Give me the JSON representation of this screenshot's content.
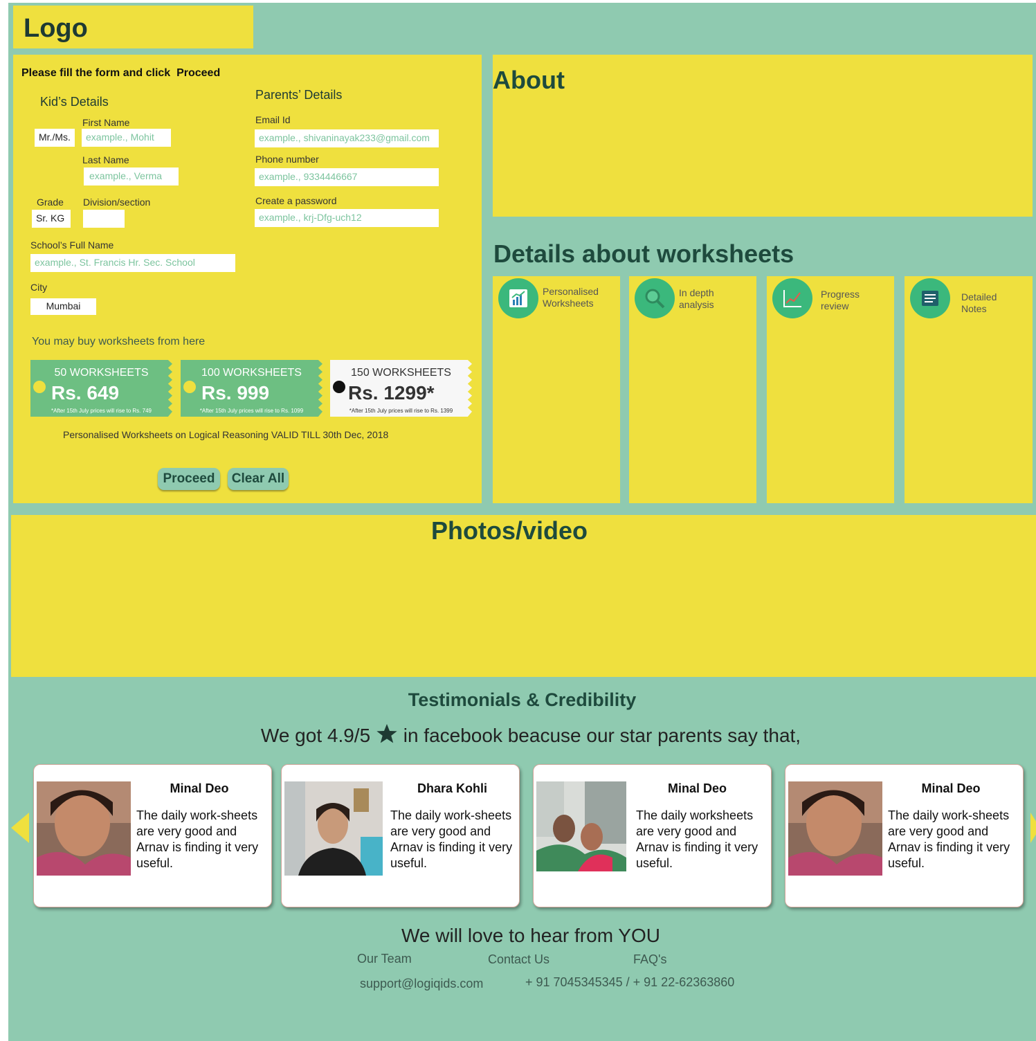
{
  "header": {
    "logo": "Logo"
  },
  "form": {
    "instruction": "Please fill the form and click  Proceed",
    "kids_heading": "Kid’s Details",
    "parents_heading": "Parents’ Details",
    "salutation": "Mr./Ms.",
    "first_name_label": "First Name",
    "first_name_placeholder": "example., Mohit",
    "last_name_label": "Last Name",
    "last_name_placeholder": "example., Verma",
    "grade_label": "Grade",
    "grade_value": "Sr. KG",
    "division_label": "Division/section",
    "division_value": "",
    "school_label": "School’s Full Name",
    "school_placeholder": "example., St. Francis Hr. Sec. School",
    "city_label": "City",
    "city_value": "Mumbai",
    "email_label": "Email Id",
    "email_placeholder": "example., shivaninayak233@gmail.com",
    "phone_label": "Phone number",
    "phone_placeholder": "example., 9334446667",
    "password_label": "Create a password",
    "password_placeholder": "example., krj-Dfg-uch12",
    "buy_text": "You may buy worksheets from here",
    "plans": [
      {
        "title": "50 WORKSHEETS",
        "price": "Rs. 649",
        "note": "*After 15th July prices will rise to Rs. 749",
        "selected": false
      },
      {
        "title": "100 WORKSHEETS",
        "price": "Rs. 999",
        "note": "*After 15th July prices will rise to Rs. 1099",
        "selected": false
      },
      {
        "title": "150 WORKSHEETS",
        "price": "Rs. 1299*",
        "note": "*After 15th July prices will rise to Rs. 1399",
        "selected": true
      }
    ],
    "validity": "Personalised Worksheets on Logical Reasoning VALID TILL 30th Dec, 2018",
    "proceed_label": "Proceed",
    "clear_label": "Clear All"
  },
  "about": {
    "title": "About"
  },
  "worksheets": {
    "title": "Details about worksheets",
    "features": [
      {
        "line1": "Personalised",
        "line2": "Worksheets",
        "icon": "bar-chart-icon"
      },
      {
        "line1": "In depth",
        "line2": "analysis",
        "icon": "magnifier-icon"
      },
      {
        "line1": "Progress",
        "line2": "review",
        "icon": "trend-chart-icon"
      },
      {
        "line1": "Detailed",
        "line2": "Notes",
        "icon": "notes-icon"
      }
    ]
  },
  "media": {
    "title": "Photos/video"
  },
  "testimonials": {
    "title": "Testimonials & Credibility",
    "rating_before": "We got 4.9/5",
    "rating_after": "in facebook beacuse our star parents say that,",
    "cards": [
      {
        "name": "Minal Deo",
        "quote": "The daily work-sheets are very good and Arnav is finding it very useful."
      },
      {
        "name": "Dhara Kohli",
        "quote": "The daily work-sheets are very good and Arnav is finding it very useful."
      },
      {
        "name": "Minal Deo",
        "quote": "The daily worksheets are very good and Arnav is finding it very useful."
      },
      {
        "name": "Minal Deo",
        "quote": "The daily work-sheets are very good and Arnav is finding it very useful."
      }
    ]
  },
  "footer": {
    "tagline": "We will love to hear from YOU",
    "links": [
      "Our Team",
      "Contact Us",
      "FAQ's"
    ],
    "email": "support@logiqids.com",
    "phone": "+ 91 7045345345 / + 91 22-62363860"
  },
  "colors": {
    "background": "#8fcab0",
    "panel": "#efe03e",
    "heading": "#1e4a3d",
    "accent": "#6dbf82"
  }
}
